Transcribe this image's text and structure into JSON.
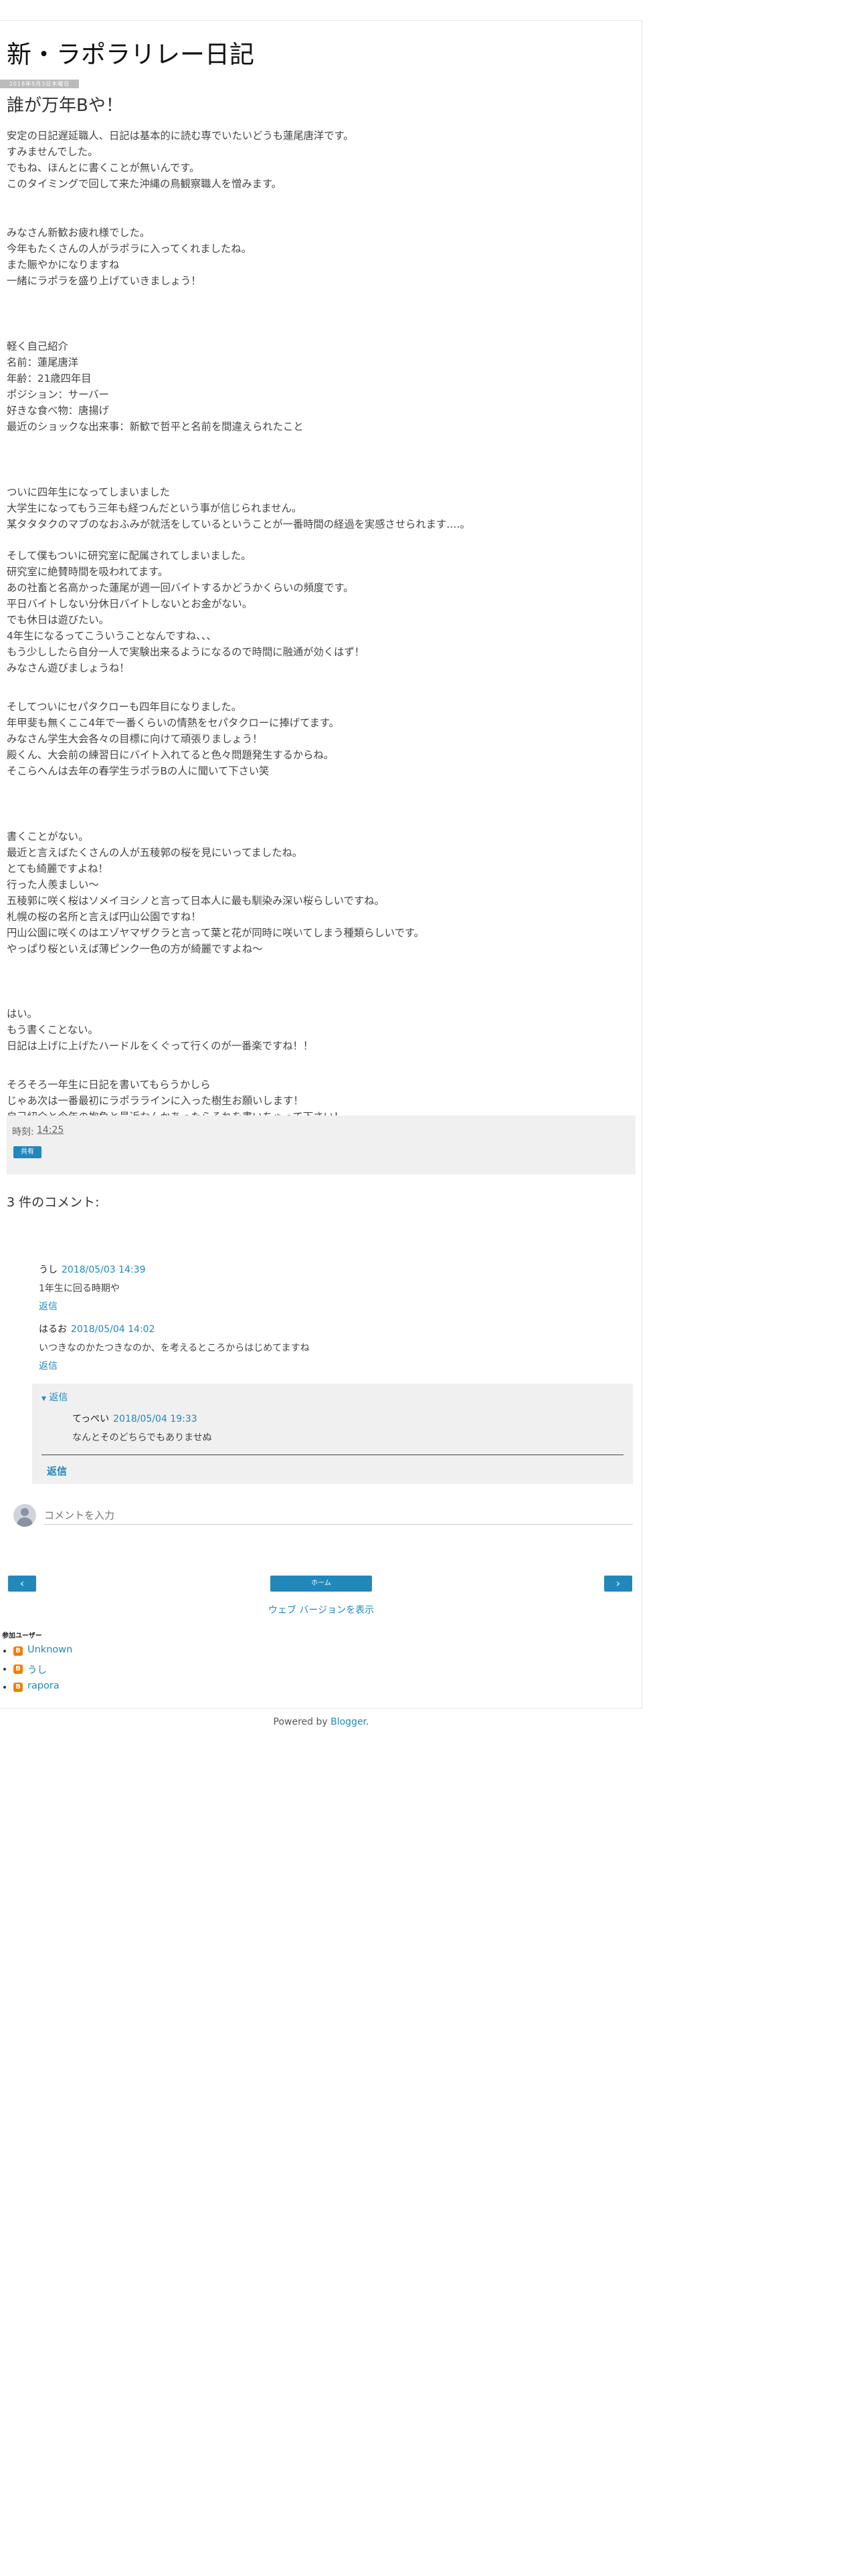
{
  "blog": {
    "title": "新・ラポラリレー日記"
  },
  "post": {
    "date_badge": "2018年5月3日木曜日",
    "title": "誰が万年Bや！",
    "lines": [
      "安定の日記遅延職人、日記は基本的に読む専でいたいどうも蓮尾唐洋です。",
      "すみませんでした。",
      "でもね、ほんとに書くことが無いんです。",
      "このタイミングで回して来た沖縄の鳥観察職人を憎みます。",
      "みなさん新歓お疲れ様でした。",
      "今年もたくさんの人がラポラに入ってくれましたね。",
      "また賑やかになりますね",
      "一緒にラポラを盛り上げていきましょう！",
      "軽く自己紹介",
      "名前：蓮尾唐洋",
      "年齢：21歳四年目",
      "ポジション：サーバー",
      "好きな食べ物：唐揚げ",
      "最近のショックな出来事：新歓で哲平と名前を間違えられたこと",
      "ついに四年生になってしまいました",
      "大学生になってもう三年も経つんだという事が信じられません。",
      "某タタタクのマブのなおふみが就活をしているということが一番時間の経過を実感させられます….。",
      "そして僕もついに研究室に配属されてしまいました。",
      "研究室に絶賛時間を吸われてます。",
      "あの社畜と名高かった蓮尾が週一回バイトするかどうかくらいの頻度です。",
      "平日バイトしない分休日バイトしないとお金がない。",
      "でも休日は遊びたい。",
      "4年生になるってこういうことなんですね、、、",
      "もう少ししたら自分一人で実験出来るようになるので時間に融通が効くはず！",
      "みなさん遊びましょうね！",
      "そしてついにセパタクローも四年目になりました。",
      "年甲斐も無くここ4年で一番くらいの情熱をセパタクローに捧げてます。",
      "みなさん学生大会各々の目標に向けて頑張りましょう！",
      "殿くん、大会前の練習日にバイト入れてると色々問題発生するからね。",
      "そこらへんは去年の春学生ラポラBの人に聞いて下さい笑",
      "書くことがない。",
      "最近と言えばたくさんの人が五稜郭の桜を見にいってましたね。",
      "とても綺麗ですよね！",
      "行った人羨ましい〜",
      "五稜郭に咲く桜はソメイヨシノと言って日本人に最も馴染み深い桜らしいですね。",
      "札幌の桜の名所と言えば円山公園ですね！",
      "円山公園に咲くのはエゾヤマザクラと言って葉と花が同時に咲いてしまう種類らしいです。",
      "やっぱり桜といえば薄ピンク一色の方が綺麗ですよね〜",
      "はい。",
      "もう書くことない。",
      "日記は上げに上げたハードルをくぐって行くのが一番楽ですね！！",
      "そろそろ一年生に日記を書いてもらうかしら",
      "じゃあ次は一番最初にラポララインに入った樹生お願いします！",
      "自己紹介と今年の抱負と最近なんかあったらそれを書いちゃって下さい！"
    ],
    "footer": {
      "time_label": "時刻:",
      "time_value": "14:25",
      "share_label": "共有"
    }
  },
  "comments": {
    "heading": "3 件のコメント:",
    "items": [
      {
        "author": "うし",
        "time": "2018/05/03 14:39",
        "text": "1年生に回る時期や",
        "reply": "返信"
      },
      {
        "author": "はるお",
        "time": "2018/05/04 14:02",
        "text": "いつきなのかたつきなのか、を考えるところからはじめてますね",
        "reply": "返信"
      }
    ],
    "thread": {
      "toggle": "返信",
      "reply": {
        "author": "てっぺい",
        "time": "2018/05/04 19:33",
        "text": "なんとそのどちらでもありませぬ"
      },
      "reply_button": "返信"
    },
    "input_placeholder": "コメントを入力"
  },
  "nav": {
    "prev_glyph": "‹",
    "next_glyph": "›",
    "home": "ホーム",
    "web_version": "ウェブ バージョンを表示"
  },
  "contributors": {
    "title": "参加ユーザー",
    "items": [
      {
        "name": "Unknown"
      },
      {
        "name": "うし"
      },
      {
        "name": "rapora"
      }
    ]
  },
  "powered": {
    "prefix": "Powered by ",
    "link": "Blogger",
    "suffix": "."
  },
  "colors": {
    "accent": "#2288bb",
    "footer_bg": "#f0f0f0",
    "blogger_orange": "#f57d00"
  },
  "icons": {
    "blogger": "blogger-icon",
    "avatar": "user-avatar-icon",
    "prev": "chevron-left-icon",
    "next": "chevron-right-icon",
    "toggle": "caret-down-icon"
  }
}
